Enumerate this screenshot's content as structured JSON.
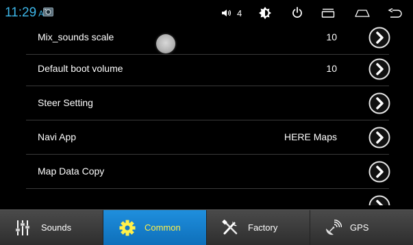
{
  "status_bar": {
    "time": "11:29",
    "ampm": "AM",
    "volume": "4",
    "icons": [
      "camera-icon",
      "volume-icon",
      "brightness-icon",
      "power-icon",
      "recent-apps-icon",
      "home-icon",
      "back-icon"
    ]
  },
  "settings": {
    "items": [
      {
        "label": "Mix_sounds scale",
        "value": "10"
      },
      {
        "label": "Default boot volume",
        "value": "10"
      },
      {
        "label": "Steer Setting",
        "value": ""
      },
      {
        "label": "Navi App",
        "value": "HERE Maps"
      },
      {
        "label": "Map Data Copy",
        "value": ""
      },
      {
        "label": "",
        "value": ""
      }
    ]
  },
  "tabs": [
    {
      "label": "Sounds",
      "icon": "equalizer-icon",
      "active": false
    },
    {
      "label": "Common",
      "icon": "gear-icon",
      "active": true
    },
    {
      "label": "Factory",
      "icon": "tools-icon",
      "active": false
    },
    {
      "label": "GPS",
      "icon": "satellite-icon",
      "active": false
    }
  ],
  "colors": {
    "clock": "#3db6e8",
    "active_tab": "#1f8fdd",
    "active_tab_label": "#fff04a"
  }
}
